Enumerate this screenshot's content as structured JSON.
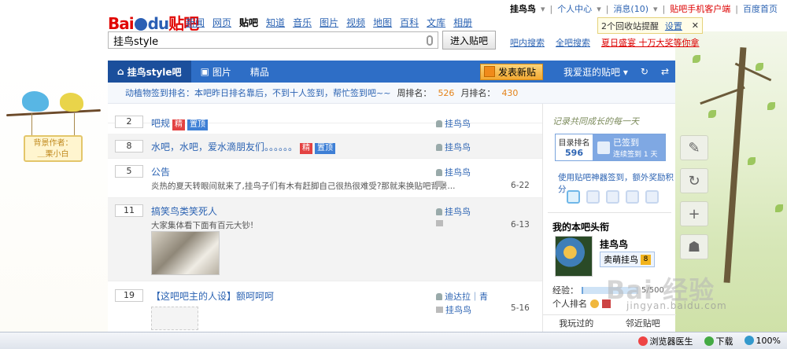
{
  "brand": {
    "logo_text_a": "Bai",
    "logo_text_b": "du",
    "logo_suffix": "贴吧"
  },
  "topnav": [
    "新闻",
    "网页",
    "贴吧",
    "知道",
    "音乐",
    "图片",
    "视频",
    "地图",
    "百科",
    "文库",
    "相册"
  ],
  "topnav_active": "贴吧",
  "userbar": {
    "username": "挂鸟鸟",
    "personal_center": "个人中心",
    "messages": "消息(10)",
    "client": "贴吧手机客户端",
    "homepage": "百度首页",
    "sep": "|"
  },
  "notice": {
    "text": "2个回收站提醒",
    "settings": "设置",
    "close": "✕"
  },
  "search": {
    "value": "挂鸟style",
    "button": "进入贴吧"
  },
  "search_links": [
    "吧内搜索",
    "全吧搜索",
    "夏日盛宴 十万大奖等你拿"
  ],
  "forumnav": {
    "tabs": [
      "挂鸟style吧",
      "图片",
      "精品"
    ],
    "post_button": "发表新贴",
    "liked": "我爱逛的贴吧"
  },
  "signbar": {
    "text": "动植物签到排名：本吧昨日排名靠后，不到十人签到，帮忙签到吧~~",
    "week_label": "周排名：",
    "week_value": "526",
    "month_label": "月排名：",
    "month_value": "430"
  },
  "threads": [
    {
      "replies": "2",
      "title": "吧规",
      "badges": [
        "精",
        "置顶"
      ],
      "author": "挂鸟鸟",
      "abstract": "",
      "date": ""
    },
    {
      "replies": "8",
      "title": "水吧，水吧，爱水滴朋友们。。。。。。",
      "badges": [
        "精",
        "置顶"
      ],
      "author": "挂鸟鸟",
      "abstract": "",
      "date": ""
    },
    {
      "replies": "5",
      "title": "公告",
      "badges": [],
      "author": "挂鸟鸟",
      "abstract": "炎热的夏天转眼间就来了,挂鸟子们有木有赶脚自己很热很难受?那就来换贴吧背景...",
      "date": "6-22"
    },
    {
      "replies": "11",
      "title": "搞笑鸟类笑死人",
      "badges": [],
      "author": "挂鸟鸟",
      "abstract": "大家集体看下面有百元大钞!",
      "date": "6-13"
    },
    {
      "replies": "19",
      "title": "【这吧吧主的人设】额呵呵呵",
      "badges": [],
      "author": "迪达拉｜青",
      "author2": "挂鸟鸟",
      "abstract": "",
      "date": "5-16"
    }
  ],
  "sidebar": {
    "banner": "记录共同成长的每一天",
    "rank_label": "目录排名",
    "rank_value": "596",
    "signed": "已签到",
    "signed_sub": "连续签到 1 天",
    "tool_link": "使用贴吧神器签到，额外奖励积分",
    "my_title": "我的本吧头衔",
    "my_name": "挂鸟鸟",
    "my_badge": "卖萌挂鸟",
    "my_level": "8",
    "exp_label": "经验：",
    "exp_value": "5",
    "exp_total": "/500",
    "exp_fraction": 0.01,
    "honor_label": "个人排名",
    "bottom_tabs": [
      "我玩过的",
      "邻近贴吧"
    ]
  },
  "left_decor": {
    "line1": "背景作者：",
    "line2": "＿栗小白"
  },
  "statusbar": [
    "浏览器医生",
    "下载",
    "100%"
  ],
  "watermark": {
    "text": "Bai 经验",
    "url": "jingyan.baidu.com"
  },
  "colors": {
    "nav_blue": "#2e6ec6",
    "link_blue": "#2d64b3",
    "accent_orange": "#e4831a",
    "logo_red": "#e10602"
  }
}
